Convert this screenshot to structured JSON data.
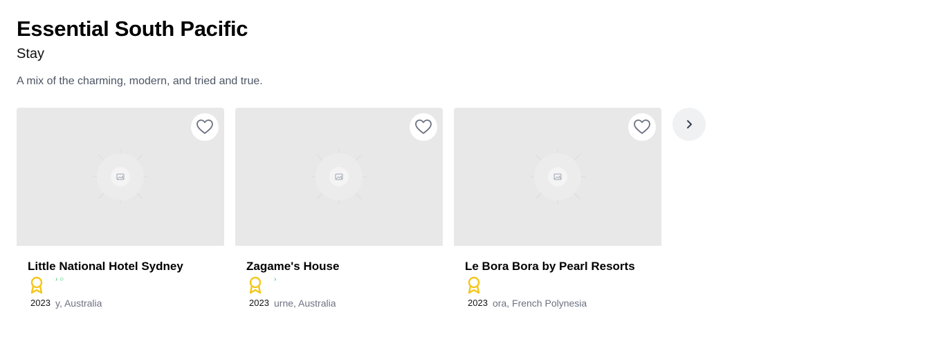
{
  "header": {
    "title": "Essential South Pacific",
    "subtitle": "Stay",
    "description": "A mix of the charming, modern, and tried and true."
  },
  "cards": [
    {
      "title": "Little National Hotel Sydney",
      "award_year": "2023",
      "location_visible": "y, Australia",
      "rating_dots": "› ○"
    },
    {
      "title": "Zagame's House",
      "award_year": "2023",
      "location_visible": "urne, Australia",
      "rating_dots": "›"
    },
    {
      "title": "Le Bora Bora by Pearl Resorts",
      "award_year": "2023",
      "location_visible": "ora, French Polynesia",
      "rating_dots": ""
    }
  ],
  "icons": {
    "favorite": "heart-outline-icon",
    "award": "award-ribbon-icon",
    "next": "chevron-right-icon",
    "placeholder": "image-placeholder-icon"
  },
  "colors": {
    "award": "#f5c518",
    "rating": "#22c55e",
    "muted_text": "#6b7280",
    "image_placeholder_bg": "#e8e8e8"
  }
}
